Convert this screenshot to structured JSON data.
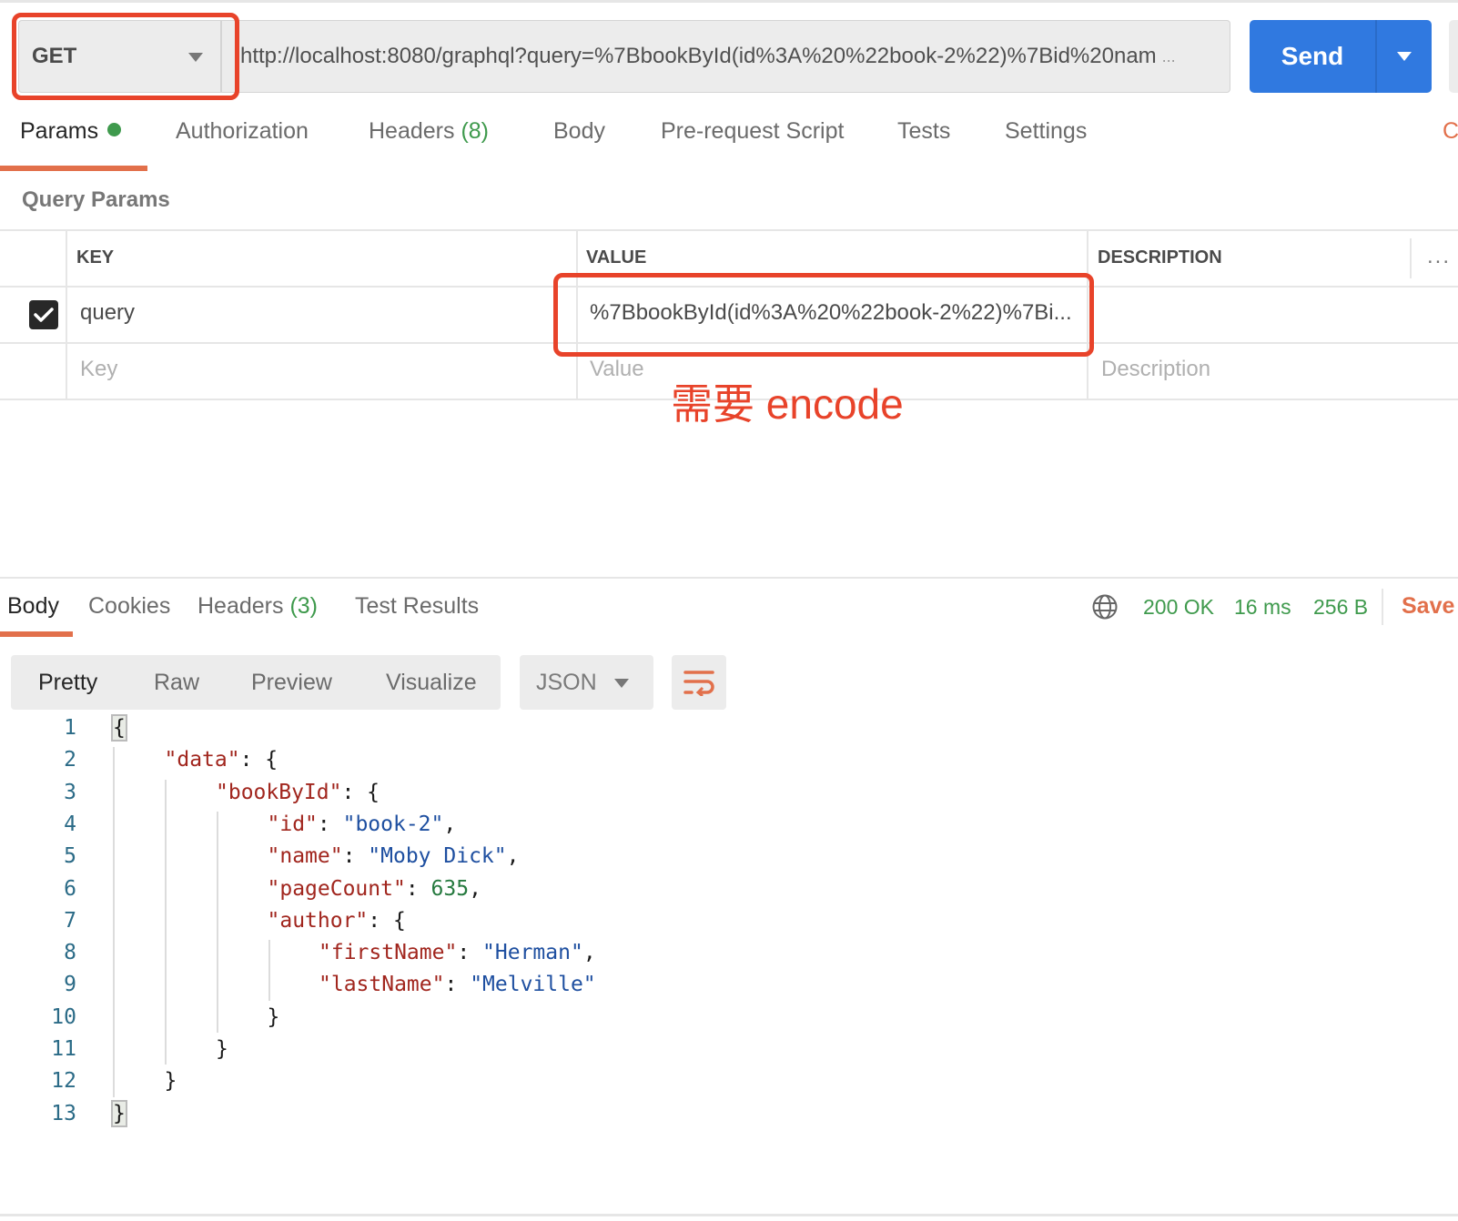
{
  "request": {
    "method": "GET",
    "url": "http://localhost:8080/graphql?query=%7BbookById(id%3A%20%22book-2%22)%7Bid%20nam",
    "url_overflow": "...",
    "send_label": "Send"
  },
  "request_tabs": [
    {
      "label": "Params",
      "active": true,
      "has_dot": true
    },
    {
      "label": "Authorization"
    },
    {
      "label": "Headers",
      "count": "(8)"
    },
    {
      "label": "Body"
    },
    {
      "label": "Pre-request Script"
    },
    {
      "label": "Tests"
    },
    {
      "label": "Settings"
    }
  ],
  "cookies_link_partial": "C",
  "query_params": {
    "title": "Query Params",
    "columns": [
      "KEY",
      "VALUE",
      "DESCRIPTION"
    ],
    "rows": [
      {
        "checked": true,
        "key": "query",
        "value": "%7BbookById(id%3A%20%22book-2%22)%7Bi...",
        "description": ""
      }
    ],
    "placeholders": {
      "key": "Key",
      "value": "Value",
      "description": "Description"
    },
    "more_icon": "..."
  },
  "annotation": {
    "text": "需要 encode",
    "color": "#e8432a"
  },
  "response_tabs": [
    {
      "label": "Body",
      "active": true
    },
    {
      "label": "Cookies"
    },
    {
      "label": "Headers",
      "count": "(3)"
    },
    {
      "label": "Test Results"
    }
  ],
  "response_status": {
    "icon": "globe-icon",
    "status": "200 OK",
    "time": "16 ms",
    "size": "256 B",
    "save_label": "Save"
  },
  "format": {
    "tabs": [
      "Pretty",
      "Raw",
      "Preview",
      "Visualize"
    ],
    "active": "Pretty",
    "language": "JSON",
    "wrap_icon": "wrap-lines-icon"
  },
  "colors": {
    "accent": "#e2704b",
    "send_blue": "#3079e0",
    "status_green": "#3f9a4d",
    "json_key": "#a1261e",
    "json_string": "#1e4fa0",
    "json_number": "#267a3f"
  },
  "code_lines": [
    {
      "n": "1",
      "indent": 0,
      "parts": [
        [
          "p",
          "{"
        ]
      ]
    },
    {
      "n": "2",
      "indent": 1,
      "parts": [
        [
          "k",
          "\"data\""
        ],
        [
          "p",
          ": {"
        ]
      ]
    },
    {
      "n": "3",
      "indent": 2,
      "parts": [
        [
          "k",
          "\"bookById\""
        ],
        [
          "p",
          ": {"
        ]
      ]
    },
    {
      "n": "4",
      "indent": 3,
      "parts": [
        [
          "k",
          "\"id\""
        ],
        [
          "p",
          ": "
        ],
        [
          "s",
          "\"book-2\""
        ],
        [
          "p",
          ","
        ]
      ]
    },
    {
      "n": "5",
      "indent": 3,
      "parts": [
        [
          "k",
          "\"name\""
        ],
        [
          "p",
          ": "
        ],
        [
          "s",
          "\"Moby Dick\""
        ],
        [
          "p",
          ","
        ]
      ]
    },
    {
      "n": "6",
      "indent": 3,
      "parts": [
        [
          "k",
          "\"pageCount\""
        ],
        [
          "p",
          ": "
        ],
        [
          "n",
          "635"
        ],
        [
          "p",
          ","
        ]
      ]
    },
    {
      "n": "7",
      "indent": 3,
      "parts": [
        [
          "k",
          "\"author\""
        ],
        [
          "p",
          ": {"
        ]
      ]
    },
    {
      "n": "8",
      "indent": 4,
      "parts": [
        [
          "k",
          "\"firstName\""
        ],
        [
          "p",
          ": "
        ],
        [
          "s",
          "\"Herman\""
        ],
        [
          "p",
          ","
        ]
      ]
    },
    {
      "n": "9",
      "indent": 4,
      "parts": [
        [
          "k",
          "\"lastName\""
        ],
        [
          "p",
          ": "
        ],
        [
          "s",
          "\"Melville\""
        ]
      ]
    },
    {
      "n": "10",
      "indent": 3,
      "parts": [
        [
          "p",
          "}"
        ]
      ]
    },
    {
      "n": "11",
      "indent": 2,
      "parts": [
        [
          "p",
          "}"
        ]
      ]
    },
    {
      "n": "12",
      "indent": 1,
      "parts": [
        [
          "p",
          "}"
        ]
      ]
    },
    {
      "n": "13",
      "indent": 0,
      "parts": [
        [
          "p",
          "}"
        ]
      ]
    }
  ]
}
